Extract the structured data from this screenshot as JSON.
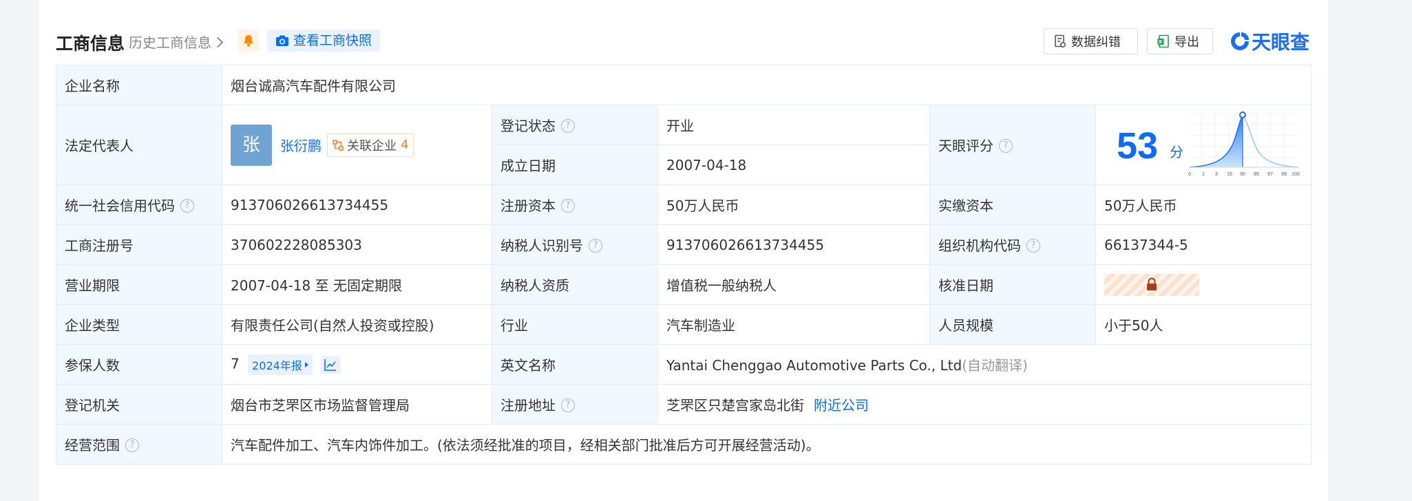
{
  "header": {
    "title": "工商信息",
    "history_link": "历史工商信息",
    "snapshot_button": "查看工商快照",
    "error_button": "数据纠错",
    "export_button": "导出",
    "logo_text": "天眼查"
  },
  "company_name": {
    "label": "企业名称",
    "value": "烟台诚高汽车配件有限公司"
  },
  "legal_rep": {
    "label": "法定代表人",
    "avatar_char": "张",
    "name": "张衍鹏",
    "related_label": "关联企业",
    "related_count": "4"
  },
  "reg_status": {
    "label": "登记状态",
    "value": "开业"
  },
  "found_date": {
    "label": "成立日期",
    "value": "2007-04-18"
  },
  "score": {
    "label": "天眼评分",
    "value": "53",
    "unit": "分",
    "axis_ticks": [
      "0",
      "1",
      "3",
      "15",
      "50",
      "85",
      "97",
      "99",
      "100"
    ]
  },
  "credit_code": {
    "label": "统一社会信用代码",
    "value": "913706026613734455"
  },
  "reg_capital": {
    "label": "注册资本",
    "value": "50万人民币"
  },
  "paid_capital": {
    "label": "实缴资本",
    "value": "50万人民币"
  },
  "reg_no": {
    "label": "工商注册号",
    "value": "370602228085303"
  },
  "taxpayer_id": {
    "label": "纳税人识别号",
    "value": "913706026613734455"
  },
  "org_code": {
    "label": "组织机构代码",
    "value": "66137344-5"
  },
  "biz_term": {
    "label": "营业期限",
    "value": "2007-04-18 至 无固定期限"
  },
  "tax_qual": {
    "label": "纳税人资质",
    "value": "增值税一般纳税人"
  },
  "approve_date": {
    "label": "核准日期"
  },
  "company_type": {
    "label": "企业类型",
    "value": "有限责任公司(自然人投资或控股)"
  },
  "industry": {
    "label": "行业",
    "value": "汽车制造业"
  },
  "staff_size": {
    "label": "人员规模",
    "value": "小于50人"
  },
  "insured": {
    "label": "参保人数",
    "value": "7",
    "report_badge": "2024年报"
  },
  "english_name": {
    "label": "英文名称",
    "value": "Yantai Chenggao Automotive Parts Co., Ltd",
    "note": "(自动翻译)"
  },
  "reg_authority": {
    "label": "登记机关",
    "value": "烟台市芝罘区市场监督管理局"
  },
  "reg_address": {
    "label": "注册地址",
    "value": "芝罘区只楚宫家岛北街",
    "nearby_link": "附近公司"
  },
  "biz_scope": {
    "label": "经营范围",
    "value": "汽车配件加工、汽车内饰件加工。(依法须经批准的项目，经相关部门批准后方可开展经营活动)。"
  },
  "colors": {
    "accent": "#0a6cff",
    "status_green": "#14a84a",
    "label_bg": "#f2f8ff",
    "orange": "#ff7a1a"
  }
}
